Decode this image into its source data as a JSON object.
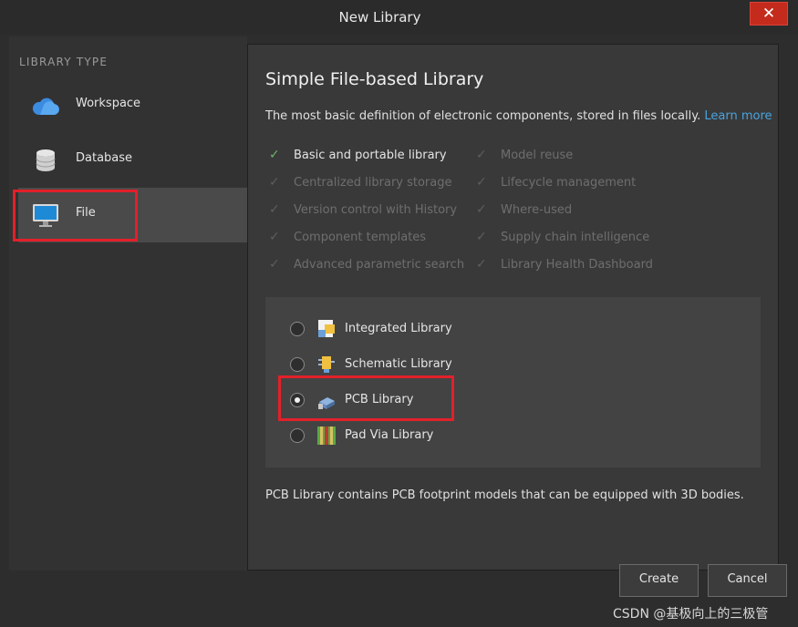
{
  "window": {
    "title": "New Library",
    "close_glyph": "✕"
  },
  "sidebar": {
    "section_label": "LIBRARY TYPE",
    "items": [
      {
        "label": "Workspace",
        "icon": "cloud-icon"
      },
      {
        "label": "Database",
        "icon": "database-icon"
      },
      {
        "label": "File",
        "icon": "monitor-icon",
        "selected": true
      }
    ]
  },
  "main": {
    "heading": "Simple File-based Library",
    "description": "The most basic definition of electronic components, stored in files locally.",
    "learn_more": "Learn more",
    "features_left": [
      {
        "label": "Basic and portable library",
        "active": true
      },
      {
        "label": "Centralized library storage",
        "active": false
      },
      {
        "label": "Version control with History",
        "active": false
      },
      {
        "label": "Component templates",
        "active": false
      },
      {
        "label": "Advanced parametric search",
        "active": false
      }
    ],
    "features_right": [
      {
        "label": "Model reuse",
        "active": false
      },
      {
        "label": "Lifecycle management",
        "active": false
      },
      {
        "label": "Where-used",
        "active": false
      },
      {
        "label": "Supply chain intelligence",
        "active": false
      },
      {
        "label": "Library Health Dashboard",
        "active": false
      }
    ],
    "check_glyph": "✓",
    "options": [
      {
        "label": "Integrated Library",
        "icon": "integrated-library-icon",
        "checked": false
      },
      {
        "label": "Schematic Library",
        "icon": "schematic-library-icon",
        "checked": false
      },
      {
        "label": "PCB Library",
        "icon": "pcb-library-icon",
        "checked": true
      },
      {
        "label": "Pad Via Library",
        "icon": "pad-via-library-icon",
        "checked": false
      }
    ],
    "footnote": "PCB Library contains PCB footprint models that can be equipped with 3D bodies."
  },
  "buttons": {
    "create": "Create",
    "cancel": "Cancel"
  },
  "watermark": "CSDN @基极向上的三极管",
  "colors": {
    "accent_link": "#4aa3df",
    "check_active": "#6fb36a",
    "highlight": "#e3202a",
    "close": "#c42b1c"
  }
}
